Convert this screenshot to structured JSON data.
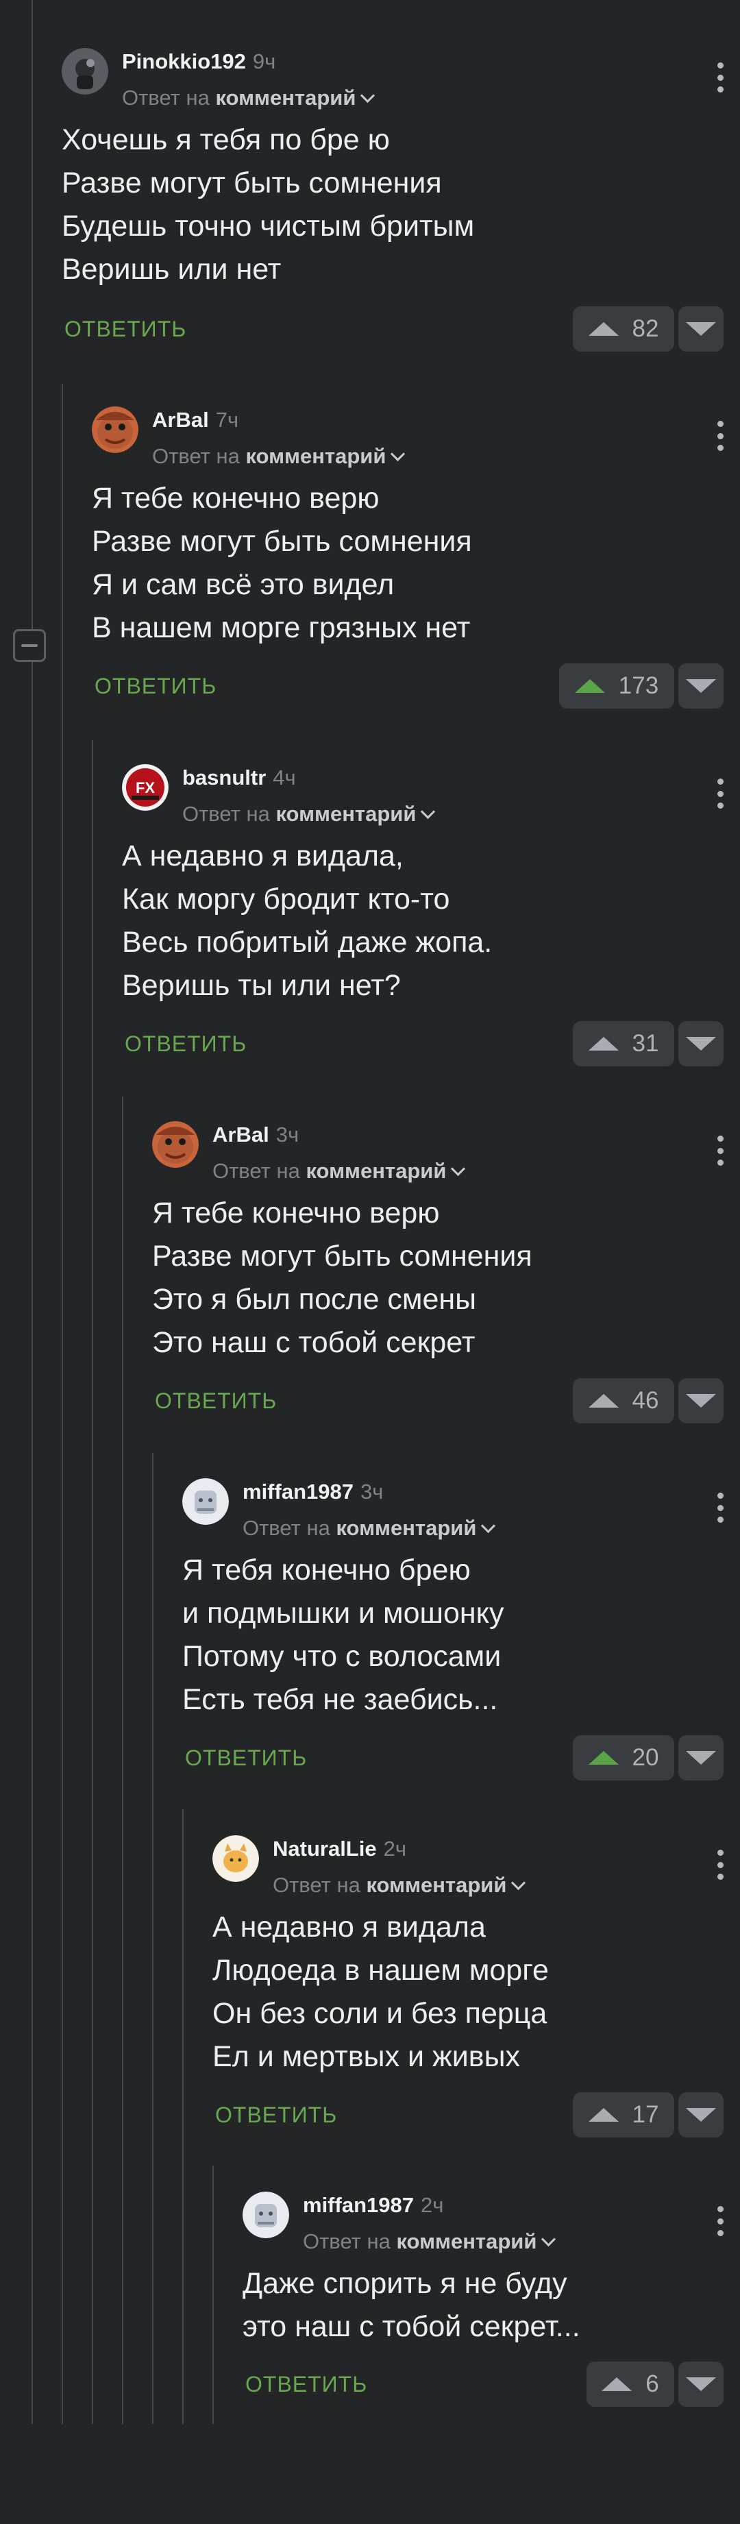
{
  "comments": [
    {
      "author": "Pinokkio192",
      "time": "9ч",
      "reply_prefix": "Ответ на",
      "reply_target": "комментарий",
      "lines": [
        "Хочешь я тебя по бре ю",
        "Разве могут быть сомнения",
        "Будешь точно чистым бритым",
        "Веришь или нет"
      ],
      "reply_label": "ОТВЕТИТЬ",
      "rating": "82",
      "upvoted": false,
      "avatar_icon": "avatar-dark-icon"
    },
    {
      "author": "ArBal",
      "time": "7ч",
      "reply_prefix": "Ответ на",
      "reply_target": "комментарий",
      "lines": [
        "Я тебе конечно верю",
        "Разве могут быть сомнения",
        "Я и сам всё это видел",
        "В нашем морге грязных нет"
      ],
      "reply_label": "ОТВЕТИТЬ",
      "rating": "173",
      "upvoted": true,
      "avatar_icon": "avatar-face-icon"
    },
    {
      "author": "basnultr",
      "time": "4ч",
      "reply_prefix": "Ответ на",
      "reply_target": "комментарий",
      "lines": [
        "А недавно я видала,",
        "Как моргу бродит кто-то",
        "Весь побритый даже жопа.",
        "Веришь ты или нет?"
      ],
      "reply_label": "ОТВЕТИТЬ",
      "rating": "31",
      "upvoted": false,
      "avatar_icon": "avatar-fx-icon"
    },
    {
      "author": "ArBal",
      "time": "3ч",
      "reply_prefix": "Ответ на",
      "reply_target": "комментарий",
      "lines": [
        "Я тебе конечно верю",
        "Разве могут быть сомнения",
        "Это я был после смены",
        "Это наш с тобой секрет"
      ],
      "reply_label": "ОТВЕТИТЬ",
      "rating": "46",
      "upvoted": false,
      "avatar_icon": "avatar-face-icon"
    },
    {
      "author": "miffan1987",
      "time": "3ч",
      "reply_prefix": "Ответ на",
      "reply_target": "комментарий",
      "lines": [
        "Я тебя конечно брею",
        "и подмышки и мошонку",
        "Потому что с волосами",
        "Есть тебя не заебись..."
      ],
      "reply_label": "ОТВЕТИТЬ",
      "rating": "20",
      "upvoted": true,
      "avatar_icon": "avatar-light-icon"
    },
    {
      "author": "NaturalLie",
      "time": "2ч",
      "reply_prefix": "Ответ на",
      "reply_target": "комментарий",
      "lines": [
        "А недавно я видала",
        "Людоеда в нашем морге",
        "Он без соли и без перца",
        "Ел и мертвых и живых"
      ],
      "reply_label": "ОТВЕТИТЬ",
      "rating": "17",
      "upvoted": false,
      "avatar_icon": "avatar-cat-icon"
    },
    {
      "author": "miffan1987",
      "time": "2ч",
      "reply_prefix": "Ответ на",
      "reply_target": "комментарий",
      "lines": [
        "Даже спорить я не буду",
        "это наш с тобой секрет..."
      ],
      "reply_label": "ОТВЕТИТЬ",
      "rating": "6",
      "upvoted": false,
      "avatar_icon": "avatar-light-icon"
    }
  ],
  "colors": {
    "accent_green": "#6aa84f",
    "upvote_green": "#5aa54a",
    "background": "#232527"
  }
}
